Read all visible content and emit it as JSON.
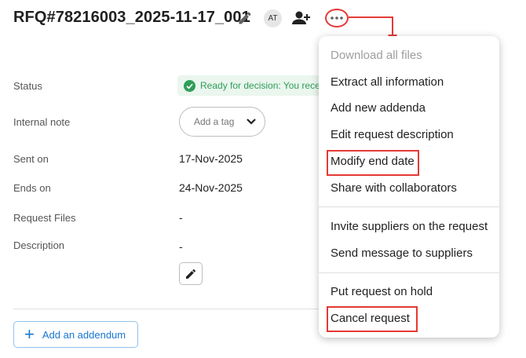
{
  "header": {
    "title": "RFQ#78216003_2025-11-17_001",
    "avatar_initials": "AT",
    "icons": [
      "pencil-icon",
      "add-user-icon",
      "more-horizontal-icon"
    ]
  },
  "fields": {
    "status_label": "Status",
    "status_value": "Ready for decision: You rece",
    "internal_note_label": "Internal note",
    "tag_placeholder": "Add a tag",
    "sent_on_label": "Sent on",
    "sent_on_value": "17-Nov-2025",
    "ends_on_label": "Ends on",
    "ends_on_value": "24-Nov-2025",
    "request_files_label": "Request Files",
    "request_files_value": "-",
    "description_label": "Description",
    "description_value": "-"
  },
  "addendum_button": {
    "plus": "+",
    "label": "Add an addendum"
  },
  "menu": {
    "items": [
      "Download all files",
      "Extract all information",
      "Add new addenda",
      "Edit request description",
      "Modify end date",
      "Share with collaborators",
      "Invite suppliers on the request",
      "Send message to suppliers",
      "Put request on hold",
      "Cancel request"
    ],
    "disabled_items": [
      "Download all files"
    ],
    "highlighted_items": [
      "Modify end date",
      "Cancel request"
    ]
  },
  "colors": {
    "highlight": "#e53935",
    "status_green": "#2e9d57",
    "status_bg": "#eaf6ee",
    "accent_blue": "#1976d2"
  }
}
